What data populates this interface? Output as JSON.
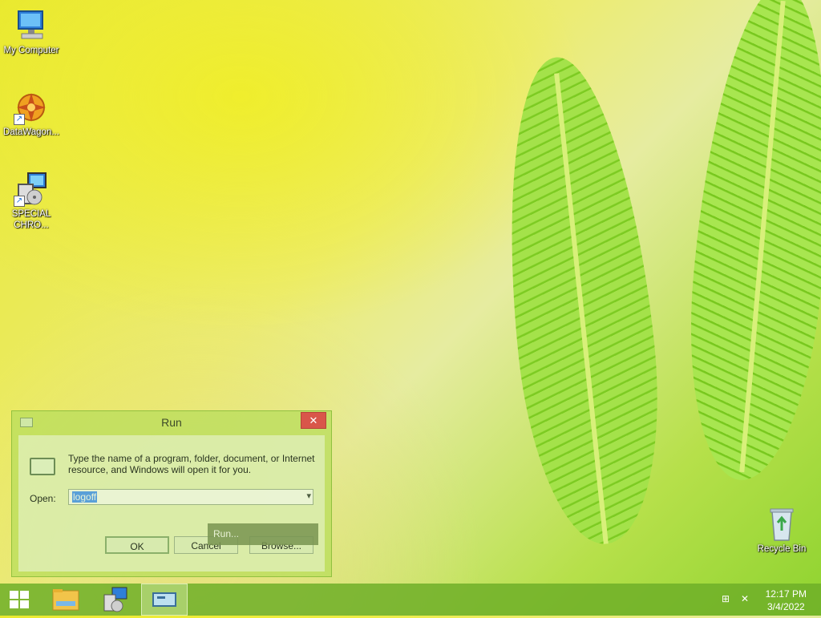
{
  "desktop": {
    "icons": [
      {
        "label": "My Computer"
      },
      {
        "label": "DataWagon..."
      },
      {
        "label": "SPECIAL CHRO..."
      },
      {
        "label": "Recycle Bin"
      }
    ]
  },
  "run_dialog": {
    "title": "Run",
    "close_glyph": "✕",
    "description": "Type the name of a program, folder, document, or Internet resource, and Windows will open it for you.",
    "open_label": "Open:",
    "open_value": "logoff",
    "ok_label": "OK",
    "cancel_label": "Cancel",
    "browse_label": "Browse..."
  },
  "tooltip": {
    "text": "Run..."
  },
  "taskbar": {
    "items": [
      "start",
      "file-explorer",
      "special-chrome",
      "run"
    ],
    "time": "12:17 PM",
    "date": "3/4/2022"
  }
}
